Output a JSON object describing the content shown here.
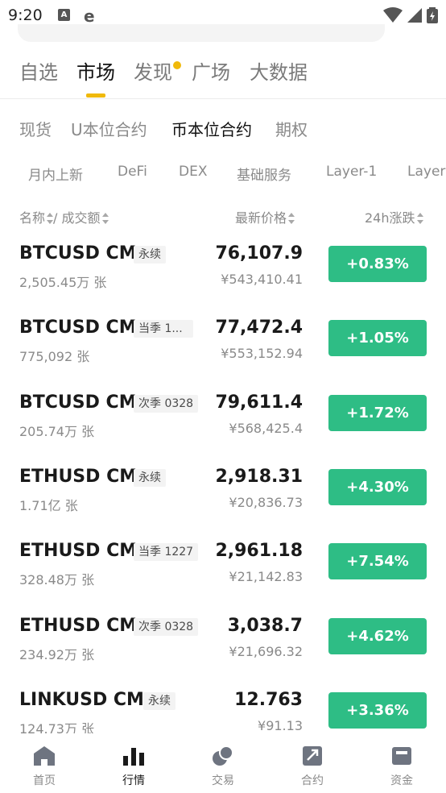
{
  "status_bar": {
    "time": "9:20",
    "icon_a": "A",
    "icon_e": "e"
  },
  "main_tabs": [
    {
      "label": "自选"
    },
    {
      "label": "市场"
    },
    {
      "label": "发现"
    },
    {
      "label": "广场"
    },
    {
      "label": "大数据"
    }
  ],
  "main_tab_active": "市场",
  "sub_tabs": [
    {
      "label": "现货"
    },
    {
      "label": "U本位合约"
    },
    {
      "label": "币本位合约"
    },
    {
      "label": "期权"
    }
  ],
  "sub_tab_active": "币本位合约",
  "categories": [
    {
      "label": "月内上新"
    },
    {
      "label": "DeFi"
    },
    {
      "label": "DEX"
    },
    {
      "label": "基础服务"
    },
    {
      "label": "Layer-1"
    },
    {
      "label": "Layer"
    }
  ],
  "columns": {
    "name": "名称",
    "separator": "/",
    "volume": "成交额",
    "last_price": "最新价格",
    "change": "24h涨跌"
  },
  "rows": [
    {
      "symbol": "BTCUSD CM",
      "tag": "永续",
      "volume": "2,505.45万 张",
      "price": "76,107.9",
      "cny": "¥543,410.41",
      "change": "+0.83%"
    },
    {
      "symbol": "BTCUSD CM",
      "tag": "当季 1...",
      "volume": "775,092 张",
      "price": "77,472.4",
      "cny": "¥553,152.94",
      "change": "+1.05%"
    },
    {
      "symbol": "BTCUSD CM",
      "tag": "次季 0328",
      "volume": "205.74万 张",
      "price": "79,611.4",
      "cny": "¥568,425.4",
      "change": "+1.72%"
    },
    {
      "symbol": "ETHUSD CM",
      "tag": "永续",
      "volume": "1.71亿 张",
      "price": "2,918.31",
      "cny": "¥20,836.73",
      "change": "+4.30%"
    },
    {
      "symbol": "ETHUSD CM",
      "tag": "当季 1227",
      "volume": "328.48万 张",
      "price": "2,961.18",
      "cny": "¥21,142.83",
      "change": "+7.54%"
    },
    {
      "symbol": "ETHUSD CM",
      "tag": "次季 0328",
      "volume": "234.92万 张",
      "price": "3,038.7",
      "cny": "¥21,696.32",
      "change": "+4.62%"
    },
    {
      "symbol": "LINKUSD CM",
      "tag": "永续",
      "volume": "124.73万 张",
      "price": "12.763",
      "cny": "¥91.13",
      "change": "+3.36%"
    }
  ],
  "bottom_nav": [
    {
      "label": "首页",
      "icon": "home-icon"
    },
    {
      "label": "行情",
      "icon": "market-chart-icon"
    },
    {
      "label": "交易",
      "icon": "trade-coins-icon"
    },
    {
      "label": "合约",
      "icon": "futures-icon"
    },
    {
      "label": "资金",
      "icon": "wallet-icon"
    }
  ],
  "colors": {
    "accent": "#f0b90b",
    "positive": "#2ebd85"
  }
}
